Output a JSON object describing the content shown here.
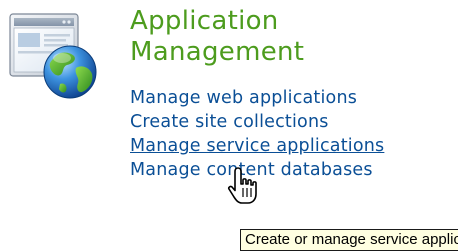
{
  "section": {
    "icon": "server-globe-icon",
    "title_line1": "Application",
    "title_line2": "Management",
    "links": [
      {
        "label": "Manage web applications"
      },
      {
        "label": "Create site collections"
      },
      {
        "label": "Manage service applications"
      },
      {
        "label": "Manage content databases"
      }
    ]
  },
  "tooltip": {
    "text": "Create or manage service applications."
  },
  "cursor": {
    "icon": "hand-pointer-icon"
  },
  "colors": {
    "title": "#4d9c1e",
    "link": "#0b4f96",
    "tooltip_bg": "#ffffe1"
  }
}
